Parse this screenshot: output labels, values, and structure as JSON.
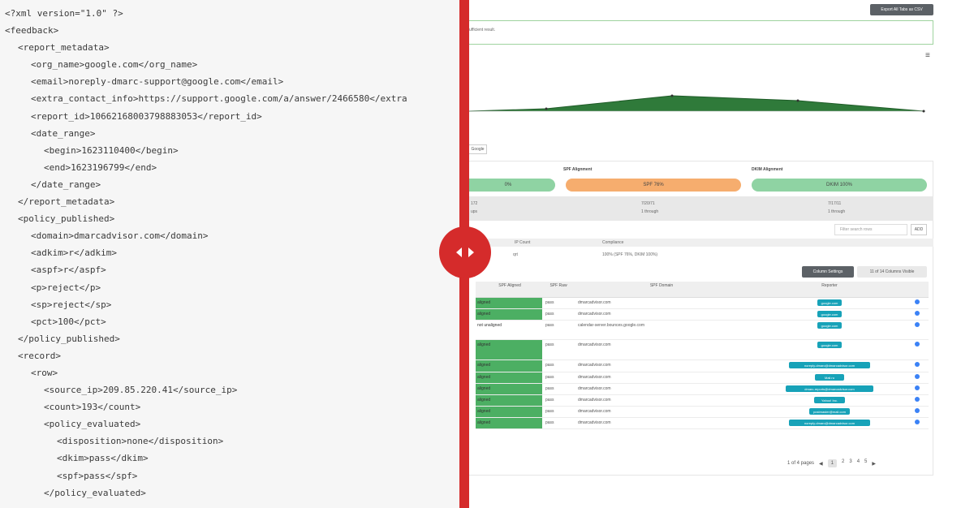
{
  "xml": {
    "lines": [
      {
        "indent": 0,
        "text": "<?xml version=\"1.0\" ?>"
      },
      {
        "indent": 0,
        "text": "<feedback>"
      },
      {
        "indent": 1,
        "text": "<report_metadata>"
      },
      {
        "indent": 2,
        "text": "<org_name>google.com</org_name>"
      },
      {
        "indent": 2,
        "text": "<email>noreply-dmarc-support@google.com</email>"
      },
      {
        "indent": 2,
        "text": "<extra_contact_info>https://support.google.com/a/answer/2466580</extra"
      },
      {
        "indent": 2,
        "text": "<report_id>10662168003798883053</report_id>"
      },
      {
        "indent": 2,
        "text": "<date_range>"
      },
      {
        "indent": 3,
        "text": "<begin>1623110400</begin>"
      },
      {
        "indent": 3,
        "text": "<end>1623196799</end>"
      },
      {
        "indent": 2,
        "text": "</date_range>"
      },
      {
        "indent": 1,
        "text": "</report_metadata>"
      },
      {
        "indent": 1,
        "text": "<policy_published>"
      },
      {
        "indent": 2,
        "text": "<domain>dmarcadvisor.com</domain>"
      },
      {
        "indent": 2,
        "text": "<adkim>r</adkim>"
      },
      {
        "indent": 2,
        "text": "<aspf>r</aspf>"
      },
      {
        "indent": 2,
        "text": "<p>reject</p>"
      },
      {
        "indent": 2,
        "text": "<sp>reject</sp>"
      },
      {
        "indent": 2,
        "text": "<pct>100</pct>"
      },
      {
        "indent": 1,
        "text": "</policy_published>"
      },
      {
        "indent": 1,
        "text": "<record>"
      },
      {
        "indent": 2,
        "text": "<row>"
      },
      {
        "indent": 3,
        "text": "<source_ip>209.85.220.41</source_ip>"
      },
      {
        "indent": 3,
        "text": "<count>193</count>"
      },
      {
        "indent": 3,
        "text": "<policy_evaluated>"
      },
      {
        "indent": 4,
        "text": "<disposition>none</disposition>"
      },
      {
        "indent": 4,
        "text": "<dkim>pass</dkim>"
      },
      {
        "indent": 4,
        "text": "<spf>pass</spf>"
      },
      {
        "indent": 3,
        "text": "</policy_evaluated>"
      }
    ]
  },
  "dashboard": {
    "export_label": "Export All Tabs as CSV",
    "panel_text": "ufficient result.",
    "tab_label": "Google",
    "alignment": {
      "spf_title": "SPF Alignment",
      "dkim_title": "DKIM Alignment",
      "first_pill": "0%",
      "spf_pill": "SPF 76%",
      "dkim_pill": "DKIM 100%"
    },
    "stats": {
      "left_top": "172",
      "left_bottom": "ups",
      "mid_top": "7/20/71",
      "mid_bottom": "1 through",
      "right_top": "7/17/11",
      "right_bottom": "1 through"
    },
    "search_placeholder": "Filter search rows",
    "add_label": "ADD",
    "mini_table": {
      "col1": "IP Count",
      "col2": "Compliance",
      "val1": "qrt",
      "val2": "100% (SPF 76%, DKIM 100%)"
    },
    "column_settings_label": "Column Settings",
    "columns_visible_label": "11 of 14 Columns Visible",
    "table": {
      "headers": [
        "SPF Aligned",
        "SPF Raw",
        "SPF Domain",
        "Reporter"
      ],
      "rows": [
        {
          "dkim": "aligned",
          "spf": "pass",
          "domain": "dmarcadvisor.com",
          "reporter": "google.com"
        },
        {
          "dkim": "aligned",
          "spf": "pass",
          "domain": "dmarcadvisor.com",
          "reporter": "google.com"
        },
        {
          "dkim": "not unaligned",
          "spf": "pass",
          "domain": "calendar-server.bounces.google.com",
          "reporter": "google.com"
        },
        {
          "dkim": "aligned",
          "spf": "pass",
          "domain": "dmarcadvisor.com",
          "reporter": "google.com"
        },
        {
          "dkim": "aligned",
          "spf": "pass",
          "domain": "dmarcadvisor.com",
          "reporter": "noreply-dmarc@dmarcadvisor.com"
        },
        {
          "dkim": "aligned",
          "spf": "pass",
          "domain": "dmarcadvisor.com",
          "reporter": "Mail.ru"
        },
        {
          "dkim": "aligned",
          "spf": "pass",
          "domain": "dmarcadvisor.com",
          "reporter": "dmarc-reports@dmarcadvisor.com"
        },
        {
          "dkim": "aligned",
          "spf": "pass",
          "domain": "dmarcadvisor.com",
          "reporter": "Yahoo! Inc."
        },
        {
          "dkim": "aligned",
          "spf": "pass",
          "domain": "dmarcadvisor.com",
          "reporter": "postmaster@mail.com"
        },
        {
          "dkim": "aligned",
          "spf": "pass",
          "domain": "dmarcadvisor.com",
          "reporter": "noreply-dmarc@dmarcadvisor.com"
        }
      ]
    },
    "pager": {
      "summary": "1 of 4 pages",
      "pages": [
        "1",
        "2",
        "3",
        "4",
        "5"
      ],
      "active": "1"
    }
  }
}
